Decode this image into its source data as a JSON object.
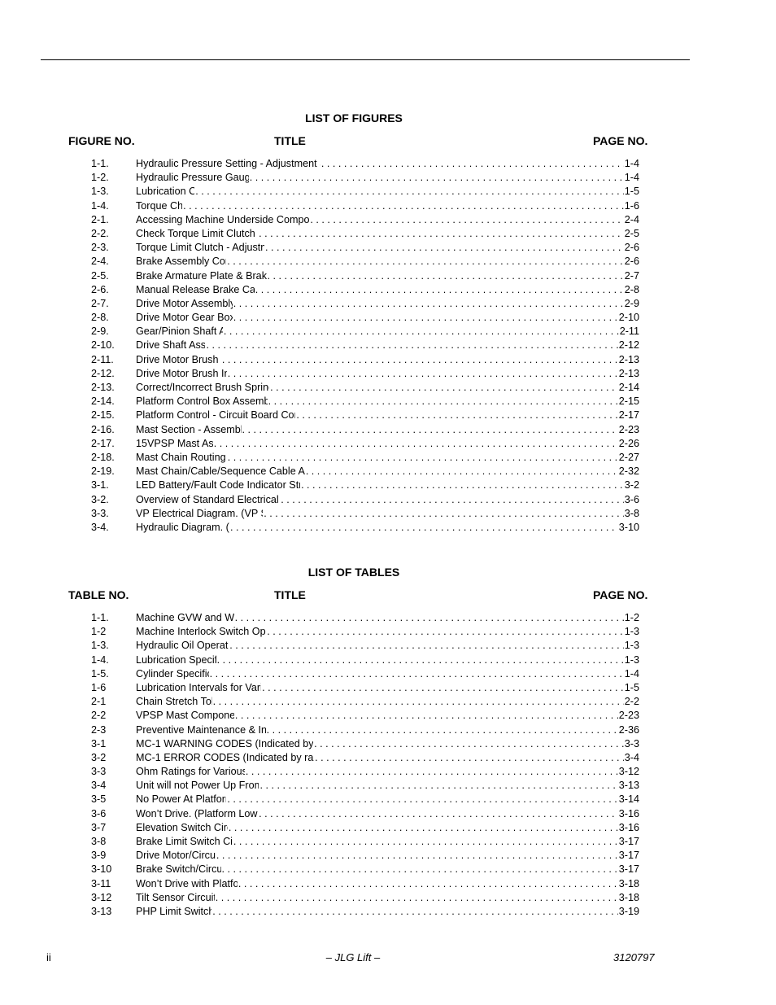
{
  "figures": {
    "section_title": "LIST OF FIGURES",
    "col_number": "FIGURE NO.",
    "col_title": "TITLE",
    "col_page": "PAGE NO.",
    "entries": [
      {
        "num": "1-1.",
        "title": "Hydraulic Pressure Setting - Adjustment Screw Located at Base of Pump Motor",
        "page": "1-4"
      },
      {
        "num": "1-2.",
        "title": "Hydraulic Pressure Gauge Installation..",
        "page": "1-4"
      },
      {
        "num": "1-3.",
        "title": "Lubrication Chart.",
        "page": "1-5"
      },
      {
        "num": "1-4.",
        "title": "Torque Chart.",
        "page": "1-6"
      },
      {
        "num": "2-1.",
        "title": "Accessing Machine Underside Components by Lifting with a Fork Truck.",
        "page": "2-4"
      },
      {
        "num": "2-2.",
        "title": "Check Torque Limit Clutch - Torque Setting.",
        "page": "2-5"
      },
      {
        "num": "2-3.",
        "title": "Torque Limit Clutch - Adjustment Components.",
        "page": "2-6"
      },
      {
        "num": "2-4.",
        "title": "Brake Assembly Components",
        "page": "2-6"
      },
      {
        "num": "2-5.",
        "title": "Brake Armature Plate & Brake Disk Adjustment.",
        "page": "2-7"
      },
      {
        "num": "2-6.",
        "title": "Manual Release Brake Cable Adjustment.",
        "page": "2-8"
      },
      {
        "num": "2-7.",
        "title": "Drive Motor Assembly Removal.",
        "page": "2-9"
      },
      {
        "num": "2-8.",
        "title": "Drive Motor Gear Box Assembly.",
        "page": "2-10"
      },
      {
        "num": "2-9.",
        "title": "Gear/Pinion Shaft Assembly.",
        "page": "2-11"
      },
      {
        "num": "2-10.",
        "title": "Drive Shaft Assembly.",
        "page": "2-12"
      },
      {
        "num": "2-11.",
        "title": "Drive Motor Brush Location.",
        "page": "2-13"
      },
      {
        "num": "2-12.",
        "title": "Drive Motor Brush Installation.",
        "page": "2-13"
      },
      {
        "num": "2-13.",
        "title": "Correct/Incorrect Brush Spring Bracket Positions..",
        "page": "2-14"
      },
      {
        "num": "2-14.",
        "title": "Platform Control Box Assembly (Exploded View).",
        "page": "2-15"
      },
      {
        "num": "2-15.",
        "title": "Platform Control - Circuit Board Component Wiring Connections.",
        "page": "2-17"
      },
      {
        "num": "2-16.",
        "title": "Mast Section - Assembly Reference.",
        "page": "2-23"
      },
      {
        "num": "2-17.",
        "title": "15VPSP Mast Assembly.",
        "page": "2-26"
      },
      {
        "num": "2-18.",
        "title": "Mast Chain Routing Diagram..",
        "page": "2-27"
      },
      {
        "num": "2-19.",
        "title": "Mast Chain/Cable/Sequence Cable Adjustment Components. (Typical)",
        "page": "2-32"
      },
      {
        "num": "3-1.",
        "title": "LED Battery/Fault Code Indicator Strip on Platform Controller Box.",
        "page": "3-2"
      },
      {
        "num": "3-2.",
        "title": "Overview of Standard Electrical System. (Sheet 1 of 2)",
        "page": "3-6"
      },
      {
        "num": "3-3.",
        "title": "VP Electrical Diagram. (VP Series - Standard)",
        "page": "3-8"
      },
      {
        "num": "3-4.",
        "title": "Hydraulic Diagram. (VP Series)",
        "page": "3-10"
      }
    ]
  },
  "tables": {
    "section_title": "LIST OF TABLES",
    "col_number": "TABLE NO.",
    "col_title": "TITLE",
    "col_page": "PAGE NO.",
    "entries": [
      {
        "num": "1-1.",
        "title": "Machine GVW and Wheel Loads",
        "page": "1-2"
      },
      {
        "num": "1-2",
        "title": "Machine Interlock Switch Operating Conditions.",
        "page": "1-3"
      },
      {
        "num": "1-3.",
        "title": "Hydraulic Oil Operating Range",
        "page": "1-3"
      },
      {
        "num": "1-4.",
        "title": "Lubrication Specifications",
        "page": "1-3"
      },
      {
        "num": "1-5.",
        "title": "Cylinder Specifications",
        "page": "1-4"
      },
      {
        "num": "1-6",
        "title": "Lubrication Intervals for Various Components",
        "page": "1-5"
      },
      {
        "num": "2-1",
        "title": "Chain Stretch Tolerance",
        "page": "2-2"
      },
      {
        "num": "2-2",
        "title": "VPSP Mast Component Features",
        "page": "2-23"
      },
      {
        "num": "2-3",
        "title": "Preventive Maintenance & Inspection Schedule.",
        "page": "2-36"
      },
      {
        "num": "3-1",
        "title": "MC-1 WARNING CODES (Indicated by 3 beeps, then slow flashing LED’s)",
        "page": "3-3"
      },
      {
        "num": "3-2",
        "title": "MC-1 ERROR CODES (Indicated by rapid LED flashing and periodic beep)",
        "page": "3-4"
      },
      {
        "num": "3-3",
        "title": "Ohm Ratings for Various Components",
        "page": "3-12"
      },
      {
        "num": "3-4",
        "title": "Unit will not Power Up From Ground Control.",
        "page": "3-13"
      },
      {
        "num": "3-5",
        "title": "No Power At Platform Control.",
        "page": "3-14"
      },
      {
        "num": "3-6",
        "title": "Won’t Drive. (Platform Lowered or Elevated)",
        "page": "3-16"
      },
      {
        "num": "3-7",
        "title": "Elevation Switch Circuit Check",
        "page": "3-16"
      },
      {
        "num": "3-8",
        "title": "Brake Limit Switch Circuit Check",
        "page": "3-17"
      },
      {
        "num": "3-9",
        "title": "Drive Motor/Circuit Check",
        "page": "3-17"
      },
      {
        "num": "3-10",
        "title": "Brake Switch/Circuit Check.",
        "page": "3-17"
      },
      {
        "num": "3-11",
        "title": "Won’t Drive with Platform Elevated",
        "page": "3-18"
      },
      {
        "num": "3-12",
        "title": "Tilt Sensor Circuit Check.",
        "page": "3-18"
      },
      {
        "num": "3-13",
        "title": "PHP Limit Switch Circuit",
        "page": "3-19"
      }
    ]
  },
  "footer": {
    "page_number": "ii",
    "center_text": "– JLG Lift –",
    "doc_number": "3120797"
  }
}
